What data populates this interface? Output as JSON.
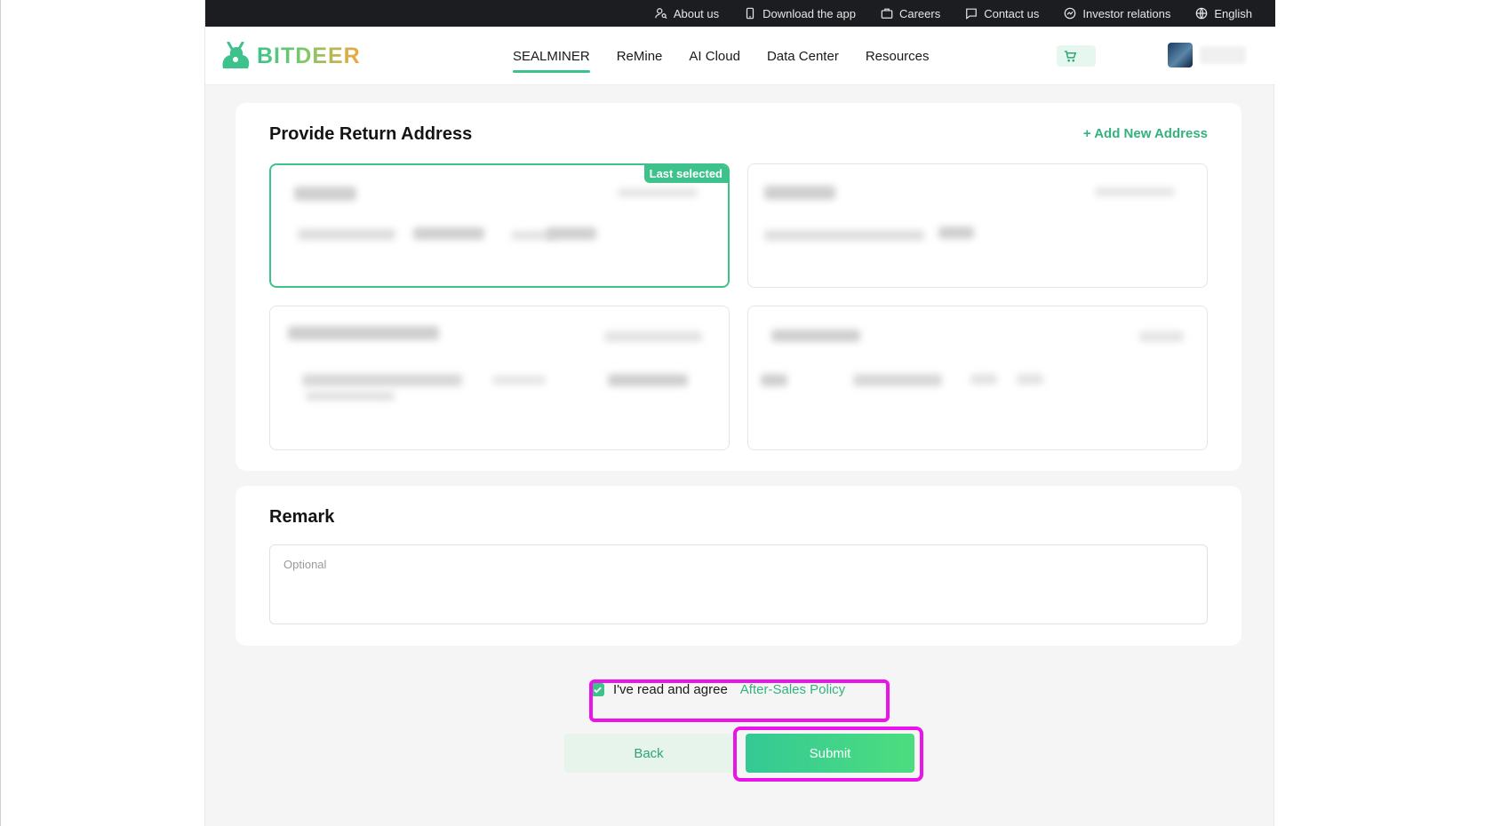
{
  "topbar": {
    "items": [
      {
        "label": "About us",
        "icon": "person-search-icon"
      },
      {
        "label": "Download the app",
        "icon": "phone-icon"
      },
      {
        "label": "Careers",
        "icon": "briefcase-icon"
      },
      {
        "label": "Contact us",
        "icon": "chat-bubble-icon"
      },
      {
        "label": "Investor relations",
        "icon": "chart-circle-icon"
      },
      {
        "label": "English",
        "icon": "globe-icon"
      }
    ]
  },
  "header": {
    "logo_text": "BITDEER",
    "nav": [
      {
        "label": "SEALMINER",
        "active": true
      },
      {
        "label": "ReMine"
      },
      {
        "label": "AI Cloud"
      },
      {
        "label": "Data Center"
      },
      {
        "label": "Resources"
      }
    ],
    "cart_icon": "cart-icon"
  },
  "address_section": {
    "title": "Provide Return Address",
    "add_new_label": "+ Add New Address",
    "selected_badge": "Last selected"
  },
  "remark_section": {
    "title": "Remark",
    "placeholder": "Optional"
  },
  "agreement": {
    "checked": true,
    "text": "I've read and agree",
    "policy_link": "After-Sales Policy"
  },
  "actions": {
    "back_label": "Back",
    "submit_label": "Submit"
  },
  "colors": {
    "brand_green": "#3ec28b",
    "highlight": "#ea14ea",
    "topbar_bg": "#1b1d21"
  }
}
